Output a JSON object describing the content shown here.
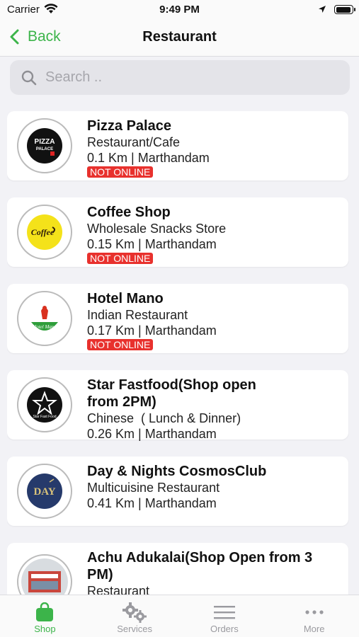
{
  "status_bar": {
    "carrier": "Carrier",
    "time": "9:49 PM"
  },
  "nav": {
    "back_label": "Back",
    "title": "Restaurant"
  },
  "search": {
    "placeholder": "Search .."
  },
  "restaurants": [
    {
      "name": "Pizza Palace",
      "category": "Restaurant/Cafe",
      "distance": "0.1 Km | Marthandam",
      "status": "NOT ONLINE",
      "logo_text": "PIZZA PALACE"
    },
    {
      "name": "Coffee Shop",
      "category": "Wholesale Snacks Store",
      "distance": "0.15 Km | Marthandam",
      "status": "NOT ONLINE",
      "logo_text": "Coffee"
    },
    {
      "name": "Hotel Mano",
      "category": "Indian Restaurant",
      "distance": "0.17 Km | Marthandam",
      "status": "NOT ONLINE",
      "logo_text": "Hotel Mano"
    },
    {
      "name": "Star Fastfood(Shop open from 2PM)",
      "category": "Chinese  ( Lunch & Dinner)",
      "distance": "0.26 Km | Marthandam",
      "status": "",
      "logo_text": "Star Fast Food"
    },
    {
      "name": "Day & Nights CosmosClub",
      "category": "Multicuisine Restaurant",
      "distance": "0.41 Km | Marthandam",
      "status": "",
      "logo_text": "DAY"
    },
    {
      "name": "Achu Adukalai(Shop Open from 3 PM)",
      "category": "Restaurant",
      "distance": "",
      "status": ""
    }
  ],
  "tabs": [
    {
      "label": "Shop",
      "icon": "shopping-bag-icon",
      "active": true
    },
    {
      "label": "Services",
      "icon": "gears-icon",
      "active": false
    },
    {
      "label": "Orders",
      "icon": "list-lines-icon",
      "active": false
    },
    {
      "label": "More",
      "icon": "ellipsis-icon",
      "active": false
    }
  ],
  "colors": {
    "accent": "#3cb44a",
    "badge": "#e8312d"
  }
}
